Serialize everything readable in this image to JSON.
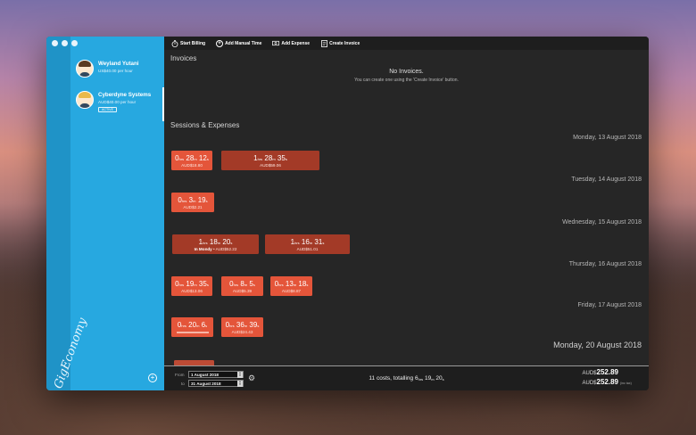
{
  "app": {
    "brand": "GigEconomy"
  },
  "clients": [
    {
      "name": "Weyland Yutani",
      "rate": "US$40.00 per hour",
      "badge": ""
    },
    {
      "name": "Cyberdyne Systems",
      "rate": "AUD$40.00 per hour",
      "badge": "ACTIVE"
    }
  ],
  "toolbar": {
    "start_billing": "Start Billing",
    "add_manual_time": "Add Manual Time",
    "add_expense": "Add Expense",
    "create_invoice": "Create Invoice"
  },
  "invoices": {
    "title": "Invoices",
    "empty_title": "No Invoices.",
    "empty_subtitle": "You can create one using the 'Create Invoice' button."
  },
  "sessions": {
    "title": "Sessions & Expenses",
    "days": [
      {
        "date": "Monday, 13 August 2018",
        "cards": [
          {
            "h": "0",
            "m": "28",
            "s": "12",
            "amount": "AUD$18.80",
            "note": ""
          },
          {
            "h": "1",
            "m": "28",
            "s": "35",
            "amount": "AUD$59.06",
            "note": ""
          }
        ]
      },
      {
        "date": "Tuesday, 14 August 2018",
        "cards": [
          {
            "h": "0",
            "m": "3",
            "s": "19",
            "amount": "AUD$2.21",
            "note": ""
          }
        ]
      },
      {
        "date": "Wednesday, 15 August 2018",
        "cards": [
          {
            "h": "1",
            "m": "18",
            "s": "20",
            "amount": "AUD$52.22",
            "note": "In Mondy"
          },
          {
            "h": "1",
            "m": "16",
            "s": "31",
            "amount": "AUD$51.01",
            "note": ""
          }
        ]
      },
      {
        "date": "Thursday, 16 August 2018",
        "cards": [
          {
            "h": "0",
            "m": "19",
            "s": "35",
            "amount": "AUD$13.06",
            "note": ""
          },
          {
            "h": "0",
            "m": "8",
            "s": "5",
            "amount": "AUD$5.39",
            "note": ""
          },
          {
            "h": "0",
            "m": "13",
            "s": "18",
            "amount": "AUD$8.87",
            "note": ""
          }
        ]
      },
      {
        "date": "Friday, 17 August 2018",
        "cards": [
          {
            "h": "0",
            "m": "20",
            "s": "6",
            "amount": "",
            "note": ""
          },
          {
            "h": "0",
            "m": "36",
            "s": "39",
            "amount": "AUD$24.43",
            "note": ""
          }
        ]
      },
      {
        "date": "Monday, 20 August 2018",
        "cards": []
      }
    ],
    "units": {
      "h": "hrs",
      "m": "m",
      "s": "s"
    }
  },
  "footer": {
    "from_label": "From",
    "to_label": "to",
    "from_value": "1 August 2018",
    "to_value": "31 August 2018",
    "summary_prefix": "11 costs, totalling",
    "summary_h": "6",
    "summary_m": "19",
    "summary_s": "20",
    "total_currency": "AUD$",
    "total_value": "252.89",
    "total_tax_currency": "AUD$",
    "total_tax_value": "252.89",
    "total_tax_note": "(inc tax)"
  }
}
